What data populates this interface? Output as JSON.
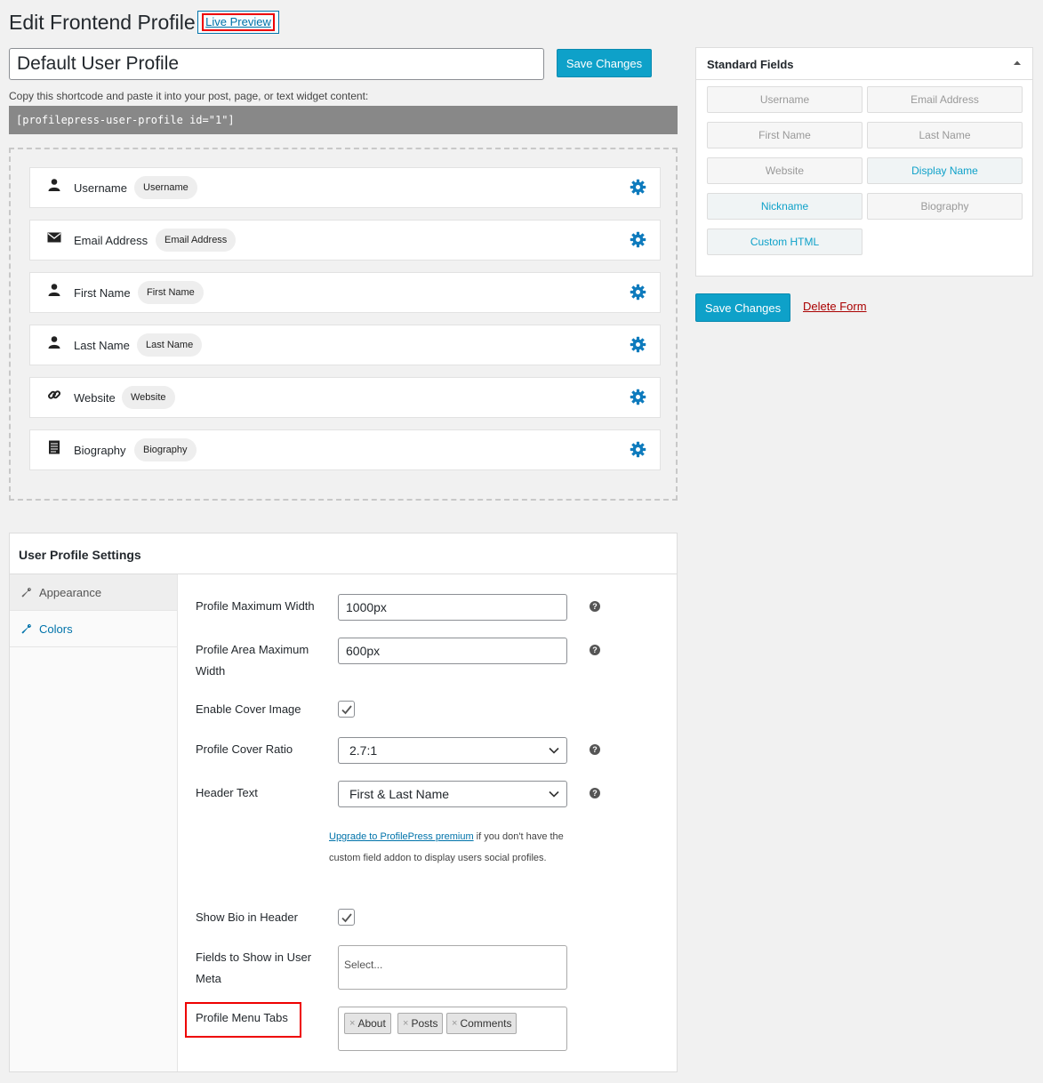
{
  "header": {
    "title": "Edit Frontend Profile",
    "live_preview": "Live Preview"
  },
  "form": {
    "title_value": "Default User Profile",
    "save_label": "Save Changes",
    "shortcode_hint": "Copy this shortcode and paste it into your post, page, or text widget content:",
    "shortcode": "[profilepress-user-profile id=\"1\"]"
  },
  "builder": {
    "fields": [
      {
        "label": "Username",
        "tag": "Username",
        "icon": "user-icon"
      },
      {
        "label": "Email Address",
        "tag": "Email Address",
        "icon": "envelope-icon"
      },
      {
        "label": "First Name",
        "tag": "First Name",
        "icon": "user-icon"
      },
      {
        "label": "Last Name",
        "tag": "Last Name",
        "icon": "user-icon"
      },
      {
        "label": "Website",
        "tag": "Website",
        "icon": "link-icon"
      },
      {
        "label": "Biography",
        "tag": "Biography",
        "icon": "document-icon"
      }
    ]
  },
  "standard_fields": {
    "title": "Standard Fields",
    "items": [
      {
        "label": "Username",
        "active": false
      },
      {
        "label": "Email Address",
        "active": false
      },
      {
        "label": "First Name",
        "active": false
      },
      {
        "label": "Last Name",
        "active": false
      },
      {
        "label": "Website",
        "active": false
      },
      {
        "label": "Display Name",
        "active": true
      },
      {
        "label": "Nickname",
        "active": true
      },
      {
        "label": "Biography",
        "active": false
      },
      {
        "label": "Custom HTML",
        "active": true
      }
    ]
  },
  "sidebar": {
    "save_label": "Save Changes",
    "delete_label": "Delete Form"
  },
  "settings": {
    "title": "User Profile Settings",
    "nav": [
      {
        "label": "Appearance",
        "selected": true
      },
      {
        "label": "Colors",
        "selected": false
      }
    ],
    "max_width_label": "Profile Maximum Width",
    "max_width_value": "1000px",
    "area_width_label": "Profile Area Maximum Width",
    "area_width_value": "600px",
    "cover_image_label": "Enable Cover Image",
    "cover_image_checked": true,
    "cover_ratio_label": "Profile Cover Ratio",
    "cover_ratio_value": "2.7:1",
    "header_text_label": "Header Text",
    "header_text_value": "First & Last Name",
    "upgrade_link": "Upgrade to ProfilePress premium",
    "upgrade_text": " if you don't have the custom field addon to display users social profiles.",
    "show_bio_label": "Show Bio in Header",
    "show_bio_checked": true,
    "user_meta_label": "Fields to Show in User Meta",
    "user_meta_placeholder": "Select...",
    "menu_tabs_label": "Profile Menu Tabs",
    "menu_tabs": [
      "About",
      "Posts",
      "Comments"
    ]
  },
  "colors": {
    "primary_button": "#0ea1c9",
    "link": "#0073aa",
    "delete": "#aa0000",
    "highlight_box": "#ee0000"
  }
}
